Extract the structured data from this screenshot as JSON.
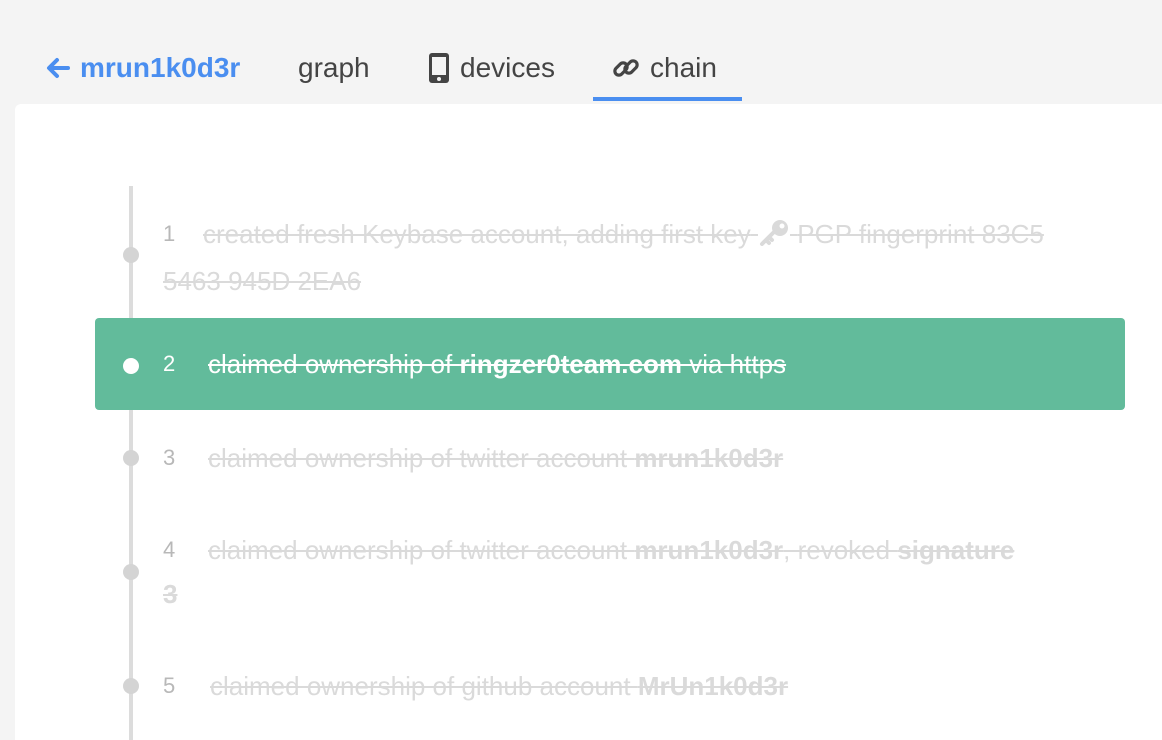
{
  "nav": {
    "back_label": "mrun1k0d3r",
    "tabs": [
      {
        "label": "graph"
      },
      {
        "label": "devices",
        "icon": "phone-icon"
      },
      {
        "label": "chain",
        "icon": "link-icon",
        "active": true
      }
    ]
  },
  "colors": {
    "accent": "#4a8ef0",
    "highlight": "#62bb9b",
    "muted_text": "#dadada",
    "timeline": "#dcdcdc"
  },
  "chain": {
    "entries": [
      {
        "num": "1",
        "prefix": "created fresh Keybase account, adding first key",
        "icon": "key-icon",
        "suffix": "PGP fingerprint 83C5 5463 945D 2EA6"
      },
      {
        "num": "2",
        "prefix": "claimed ownership of ",
        "bold": "ringzer0team.com",
        "suffix": " via https",
        "highlighted": true
      },
      {
        "num": "3",
        "prefix": "claimed ownership of twitter account ",
        "bold": "mrun1k0d3r"
      },
      {
        "num": "4",
        "prefix": "claimed ownership of twitter account ",
        "bold": "mrun1k0d3r",
        "suffix": ", revoked ",
        "bold2": "signature 3"
      },
      {
        "num": "5",
        "prefix": "claimed ownership of github account ",
        "bold": "MrUn1k0d3r"
      }
    ]
  }
}
